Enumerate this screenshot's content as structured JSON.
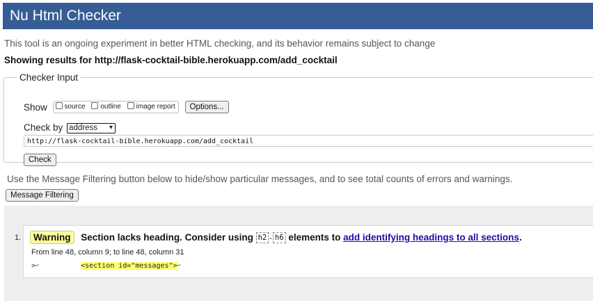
{
  "header": {
    "title": "Nu Html Checker"
  },
  "intro": "This tool is an ongoing experiment in better HTML checking, and its behavior remains subject to change",
  "showing": "Showing results for http://flask-cocktail-bible.herokuapp.com/add_cocktail",
  "checker_input": {
    "legend": "Checker Input",
    "show_label": "Show",
    "show_options": [
      "source",
      "outline",
      "image report"
    ],
    "options_button": "Options...",
    "check_by_label": "Check by",
    "check_by_value": "address",
    "url_value": "http://flask-cocktail-bible.herokuapp.com/add_cocktail",
    "check_button": "Check"
  },
  "filter_info": "Use the Message Filtering button below to hide/show particular messages, and to see total counts of errors and warnings.",
  "filter_button": "Message Filtering",
  "messages": [
    {
      "number": "1.",
      "type": "Warning",
      "text_before": "Section lacks heading. Consider using",
      "chip_1": "h2",
      "chip_sep": "-",
      "chip_2": "h6",
      "text_after": "elements to",
      "link_text": "add identifying headings to all sections",
      "link_suffix": ".",
      "location": "From line 48, column 9; to line 48, column 31",
      "extract_before": ">",
      "extract_highlight": "<section id=\"messages\">"
    }
  ],
  "colors": {
    "header_bg": "#365d95",
    "warning_bg": "#ffff9c",
    "highlight": "#ffff6c",
    "link": "#1a0dab"
  },
  "icons": {
    "line_break": "↩",
    "dropdown": "chevron-down-icon"
  }
}
